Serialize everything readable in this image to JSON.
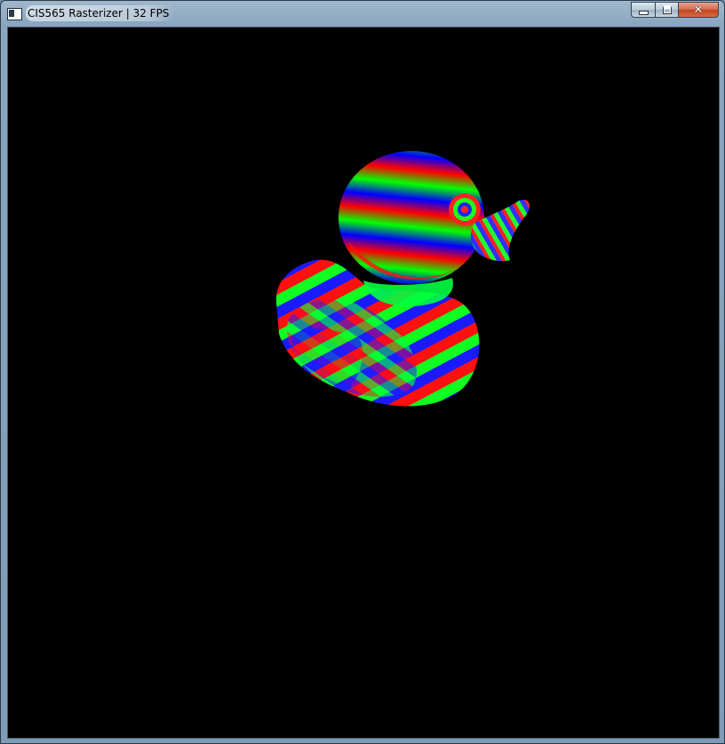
{
  "window": {
    "title": "CIS565 Rasterizer | 32 FPS",
    "controls": {
      "minimize_icon": "minimize-icon",
      "maximize_icon": "maximize-icon",
      "close_label": "✕"
    }
  },
  "scene": {
    "background": "#000000",
    "object": "duck-model",
    "palette": [
      "#ff0000",
      "#00ff00",
      "#0000ff"
    ]
  }
}
